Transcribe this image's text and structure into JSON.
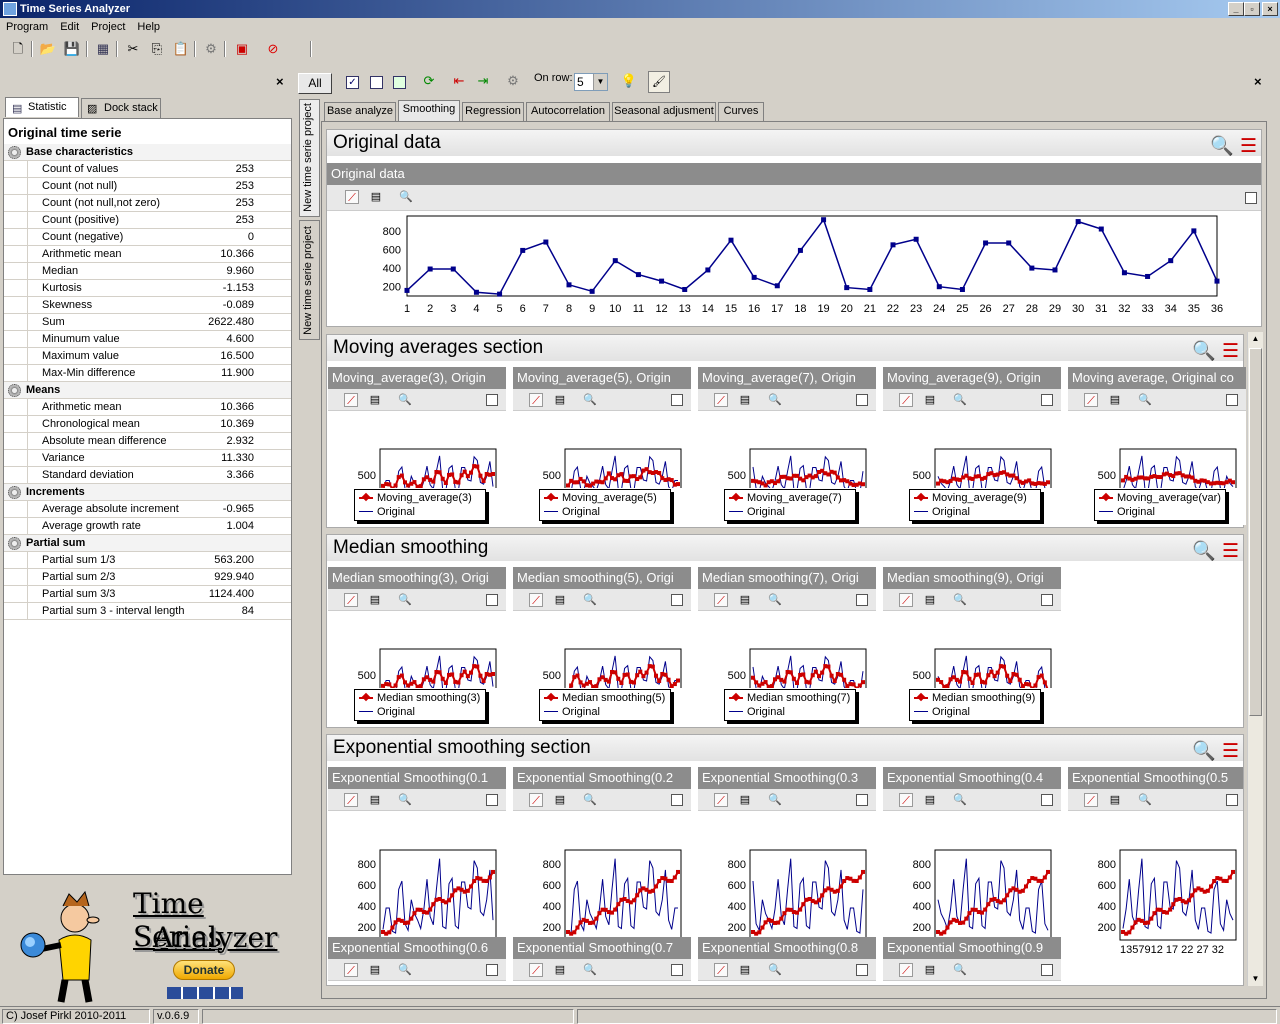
{
  "window": {
    "title": "Time Series Analyzer"
  },
  "menu": [
    "Program",
    "Edit",
    "Project",
    "Help"
  ],
  "left": {
    "tabs": [
      "Statistic",
      "Dock stack"
    ],
    "heading": "Original time serie",
    "groups": [
      {
        "name": "Base characteristics",
        "rows": [
          [
            "Count of values",
            "253"
          ],
          [
            "Count (not null)",
            "253"
          ],
          [
            "Count (not null,not zero)",
            "253"
          ],
          [
            "Count (positive)",
            "253"
          ],
          [
            "Count (negative)",
            "0"
          ],
          [
            "Arithmetic mean",
            "10.366"
          ],
          [
            "Median",
            "9.960"
          ],
          [
            "Kurtosis",
            "-1.153"
          ],
          [
            "Skewness",
            "-0.089"
          ],
          [
            "Sum",
            "2622.480"
          ],
          [
            "Minumum value",
            "4.600"
          ],
          [
            "Maximum value",
            "16.500"
          ],
          [
            "Max-Min difference",
            "11.900"
          ]
        ]
      },
      {
        "name": "Means",
        "rows": [
          [
            "Arithmetic mean",
            "10.366"
          ],
          [
            "Chronological mean",
            "10.369"
          ],
          [
            "Absolute mean difference",
            "2.932"
          ],
          [
            "Variance",
            "11.330"
          ],
          [
            "Standard deviation",
            "3.366"
          ]
        ]
      },
      {
        "name": "Increments",
        "rows": [
          [
            "Average absolute increment",
            "-0.965"
          ],
          [
            "Average growth rate",
            "1.004"
          ]
        ]
      },
      {
        "name": "Partial sum",
        "rows": [
          [
            "Partial sum 1/3",
            "563.200"
          ],
          [
            "Partial sum 2/3",
            "929.940"
          ],
          [
            "Partial sum 3/3",
            "1124.400"
          ],
          [
            "Partial sum 3 - interval length",
            "84"
          ]
        ]
      }
    ],
    "logo": {
      "line1": "Time Series",
      "line2": "Analyzer",
      "donate": "Donate"
    }
  },
  "right": {
    "all_button": "All",
    "on_row_label": "On row:",
    "on_row_value": "5",
    "vtabs": [
      "New time serie project",
      "New time serie project"
    ],
    "tabs": [
      "Base analyze",
      "Smoothing",
      "Regression",
      "Autocorrelation",
      "Seasonal adjusment",
      "Curves"
    ],
    "original": {
      "title": "Original data",
      "card": "Original data"
    },
    "ma": {
      "title": "Moving averages section",
      "cards": [
        "Moving_average(3), Origin",
        "Moving_average(5), Origin",
        "Moving_average(7), Origin",
        "Moving_average(9), Origin",
        "Moving average, Original co"
      ],
      "legends": [
        "Moving_average(3)",
        "Moving_average(5)",
        "Moving_average(7)",
        "Moving_average(9)",
        "Moving_average(var)"
      ]
    },
    "median": {
      "title": "Median smoothing",
      "cards": [
        "Median smoothing(3), Origi",
        "Median smoothing(5), Origi",
        "Median smoothing(7), Origi",
        "Median smoothing(9), Origi"
      ],
      "legends": [
        "Median smoothing(3)",
        "Median smoothing(5)",
        "Median smoothing(7)",
        "Median smoothing(9)"
      ]
    },
    "exp": {
      "title": "Exponential smoothing section",
      "cards": [
        "Exponential Smoothing(0.1",
        "Exponential Smoothing(0.2",
        "Exponential Smoothing(0.3",
        "Exponential Smoothing(0.4",
        "Exponential Smoothing(0.5",
        "Exponential Smoothing(0.6",
        "Exponential Smoothing(0.7",
        "Exponential Smoothing(0.8",
        "Exponential Smoothing(0.9"
      ]
    },
    "legend_original": "Original",
    "small_xticks": "1357912 17  22  27  32",
    "small_ytick": "500",
    "exp_yticks": [
      "800",
      "600",
      "400",
      "200"
    ]
  },
  "status": {
    "copyright": "C) Josef Pirkl 2010-2011",
    "version": "v.0.6.9"
  },
  "chart_data": {
    "type": "line",
    "title": "Original data",
    "x": [
      1,
      2,
      3,
      4,
      5,
      6,
      7,
      8,
      9,
      10,
      11,
      12,
      13,
      14,
      15,
      16,
      17,
      18,
      19,
      20,
      21,
      22,
      23,
      24,
      25,
      26,
      27,
      28,
      29,
      30,
      31,
      32,
      33,
      34,
      35,
      36
    ],
    "y": [
      160,
      390,
      390,
      140,
      120,
      590,
      680,
      220,
      150,
      480,
      330,
      260,
      170,
      380,
      700,
      300,
      210,
      590,
      920,
      190,
      170,
      650,
      710,
      200,
      170,
      670,
      670,
      400,
      380,
      900,
      820,
      350,
      310,
      480,
      800,
      260
    ],
    "yticks": [
      200,
      400,
      600,
      800
    ],
    "ylim": [
      100,
      960
    ],
    "color": "#00008b",
    "grid": false
  }
}
